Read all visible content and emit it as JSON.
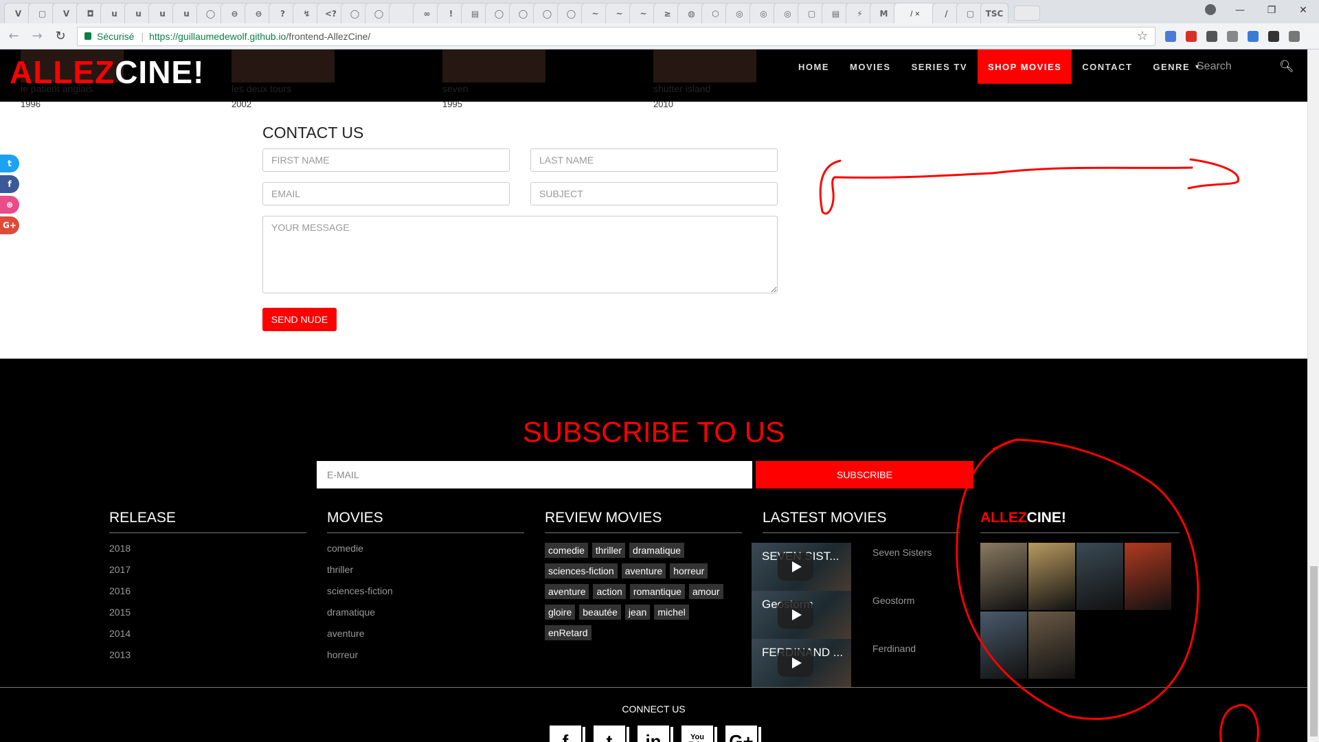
{
  "browser": {
    "tab_glyphs": [
      "V",
      "▢",
      "V",
      "◘",
      "u",
      "u",
      "u",
      "u",
      "◯",
      "⊖",
      "⊖",
      "?",
      "↯",
      "<?",
      "◯",
      "◯",
      "",
      "∞",
      "!",
      "▤",
      "◯",
      "◯",
      "◯",
      "◯",
      "~",
      "~",
      "~",
      "≥",
      "◍",
      "⬡",
      "◎",
      "◎",
      "◎",
      "▢",
      "▤",
      "⚡",
      "M",
      "/",
      "▢",
      "TSC"
    ],
    "active_tab_glyph": "/ ×",
    "secure_label": "Sécurisé",
    "url_host": "https://guillaumedewolf.github.io",
    "url_path": "/frontend-AllezCine/"
  },
  "navbar": {
    "logo_red": "ALLEZ",
    "logo_white": "CINE!",
    "menu": [
      "HOME",
      "MOVIES",
      "SERIES TV",
      "SHOP MOVIES",
      "CONTACT",
      "GENRE"
    ],
    "search_placeholder": "Search"
  },
  "strip_movies": [
    {
      "title": "le patient anglais",
      "year": "1996"
    },
    {
      "title": "les deux tours",
      "year": "2002"
    },
    {
      "title": "seven",
      "year": "1995"
    },
    {
      "title": "shutter island",
      "year": "2010"
    }
  ],
  "social_side": [
    "t",
    "f",
    "⊛",
    "G+"
  ],
  "contact": {
    "title": "CONTACT US",
    "first_name_placeholder": "FIRST NAME",
    "last_name_placeholder": "LAST NAME",
    "email_placeholder": "EMAIL",
    "subject_placeholder": "SUBJECT",
    "message_placeholder": "YOUR MESSAGE",
    "send_label": "SEND NUDE"
  },
  "subscribe": {
    "title": "SUBSCRIBE TO US",
    "email_placeholder": "E-MAIL",
    "button_label": "SUBSCRIBE"
  },
  "footer": {
    "release": {
      "title": "RELEASE",
      "items": [
        "2018",
        "2017",
        "2016",
        "2015",
        "2014",
        "2013"
      ]
    },
    "movies": {
      "title": "MOVIES",
      "items": [
        "comedie",
        "thriller",
        "sciences-fiction",
        "dramatique",
        "aventure",
        "horreur"
      ]
    },
    "review": {
      "title": "REVIEW MOVIES",
      "tags": [
        "comedie",
        "thriller",
        "dramatique",
        "sciences-fiction",
        "aventure",
        "horreur",
        "aventure",
        "action",
        "romantique",
        "amour",
        "gloire",
        "beautée",
        "jean",
        "michel",
        "enRetard"
      ]
    },
    "latest": {
      "title": "LASTEST MOVIES",
      "items": [
        {
          "thumb_text": "SEVEN SIST...",
          "name": "Seven Sisters"
        },
        {
          "thumb_text": "Geostorm",
          "name": "Geostorm"
        },
        {
          "thumb_text": "FERDINAND ...",
          "name": "Ferdinand"
        }
      ]
    },
    "brand": {
      "red": "ALLEZ",
      "white": "CINE!"
    },
    "posters": [
      "#8a7a60",
      "#b89a60",
      "#3a4a55",
      "#b03a20",
      "#4a5a6a",
      "#6a5a45"
    ],
    "connect_title": "CONNECT US",
    "connect_icons": [
      "f",
      "t",
      "in",
      "You Tube",
      "G+"
    ]
  }
}
